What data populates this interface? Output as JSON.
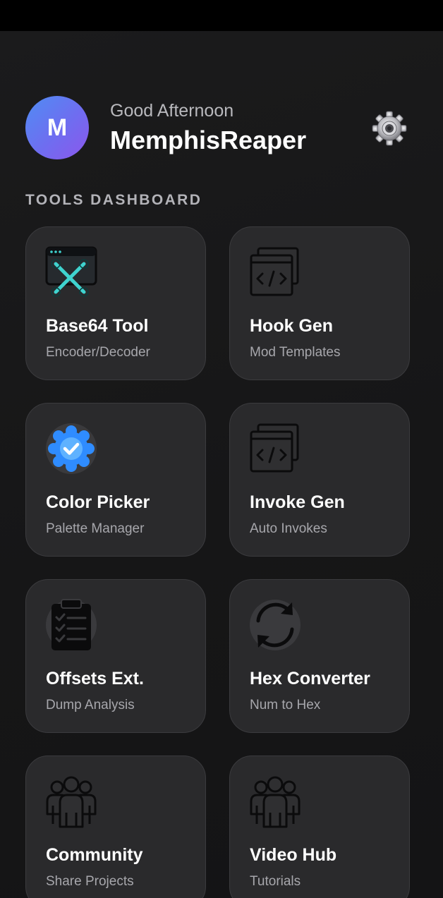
{
  "header": {
    "avatar_initial": "M",
    "greeting": "Good Afternoon",
    "username": "MemphisReaper",
    "settings_icon": "gear-icon"
  },
  "section_title": "TOOLS DASHBOARD",
  "tools": [
    {
      "title": "Base64 Tool",
      "subtitle": "Encoder/Decoder",
      "icon": "tools-window-icon"
    },
    {
      "title": "Hook Gen",
      "subtitle": "Mod Templates",
      "icon": "code-window-icon"
    },
    {
      "title": "Color Picker",
      "subtitle": "Palette Manager",
      "icon": "verified-badge-icon"
    },
    {
      "title": "Invoke Gen",
      "subtitle": "Auto Invokes",
      "icon": "code-window-icon"
    },
    {
      "title": "Offsets Ext.",
      "subtitle": "Dump Analysis",
      "icon": "clipboard-checklist-icon"
    },
    {
      "title": "Hex Converter",
      "subtitle": "Num to Hex",
      "icon": "refresh-arrows-icon"
    },
    {
      "title": "Community",
      "subtitle": "Share Projects",
      "icon": "people-group-icon"
    },
    {
      "title": "Video Hub",
      "subtitle": "Tutorials",
      "icon": "people-group-icon"
    }
  ],
  "colors": {
    "background": "#161617",
    "card": "#2a2a2c",
    "card_border": "#3b3b3e",
    "avatar_gradient_start": "#4f8df3",
    "avatar_gradient_end": "#8c57ec",
    "accent_teal": "#3fd3cf",
    "accent_blue": "#2f8cff"
  }
}
